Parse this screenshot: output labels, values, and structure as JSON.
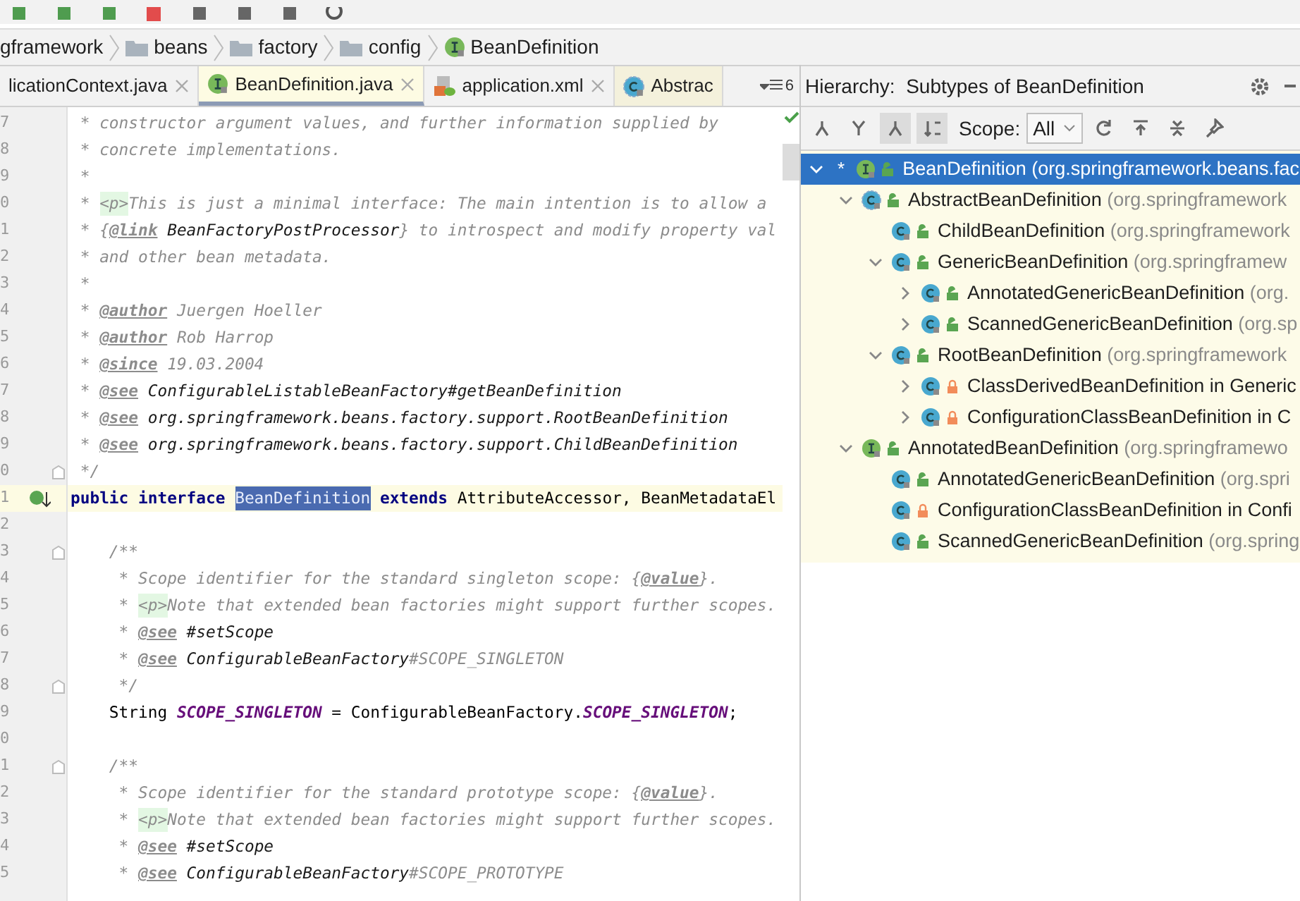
{
  "breadcrumb": [
    {
      "label": "gframework",
      "kind": "folder"
    },
    {
      "label": "beans",
      "kind": "folder"
    },
    {
      "label": "factory",
      "kind": "folder"
    },
    {
      "label": "config",
      "kind": "folder"
    },
    {
      "label": "BeanDefinition",
      "kind": "interface"
    }
  ],
  "tabs": [
    {
      "label": "licationContext.java",
      "kind": "class",
      "selected": false,
      "closable": true
    },
    {
      "label": "BeanDefinition.java",
      "kind": "interface",
      "selected": true,
      "closable": true
    },
    {
      "label": "application.xml",
      "kind": "xml",
      "selected": false,
      "closable": true
    },
    {
      "label": "Abstrac",
      "kind": "abstract",
      "selected": false,
      "closable": false
    }
  ],
  "tab_overflow_count": "6",
  "editor": {
    "lines": [
      {
        "number": "7",
        "segments": [
          {
            "text": " * constructor argument values, and further information supplied by",
            "kind": "comment"
          }
        ]
      },
      {
        "number": "8",
        "segments": [
          {
            "text": " * concrete implementations.",
            "kind": "comment"
          }
        ]
      },
      {
        "number": "9",
        "segments": [
          {
            "text": " *",
            "kind": "comment"
          }
        ]
      },
      {
        "number": "0",
        "segments": [
          {
            "text": " * ",
            "kind": "comment"
          },
          {
            "text": "<p>",
            "kind": "html"
          },
          {
            "text": "This is just a minimal interface: The main intention is to allow a",
            "kind": "comment"
          }
        ]
      },
      {
        "number": "1",
        "segments": [
          {
            "text": " * {",
            "kind": "comment"
          },
          {
            "text": "@link",
            "kind": "doctag"
          },
          {
            "text": " BeanFactoryPostProcessor",
            "kind": "ref"
          },
          {
            "text": "} to introspect and modify property val",
            "kind": "comment"
          }
        ]
      },
      {
        "number": "2",
        "segments": [
          {
            "text": " * and other bean metadata.",
            "kind": "comment"
          }
        ]
      },
      {
        "number": "3",
        "segments": [
          {
            "text": " *",
            "kind": "comment"
          }
        ]
      },
      {
        "number": "4",
        "segments": [
          {
            "text": " * ",
            "kind": "comment"
          },
          {
            "text": "@author",
            "kind": "doctag"
          },
          {
            "text": " Juergen Hoeller",
            "kind": "comment"
          }
        ]
      },
      {
        "number": "5",
        "segments": [
          {
            "text": " * ",
            "kind": "comment"
          },
          {
            "text": "@author",
            "kind": "doctag"
          },
          {
            "text": " Rob Harrop",
            "kind": "comment"
          }
        ]
      },
      {
        "number": "6",
        "segments": [
          {
            "text": " * ",
            "kind": "comment"
          },
          {
            "text": "@since",
            "kind": "doctag"
          },
          {
            "text": " 19.03.2004",
            "kind": "comment"
          }
        ]
      },
      {
        "number": "7",
        "segments": [
          {
            "text": " * ",
            "kind": "comment"
          },
          {
            "text": "@see",
            "kind": "doctag"
          },
          {
            "text": " ConfigurableListableBeanFactory#getBeanDefinition",
            "kind": "ref"
          }
        ]
      },
      {
        "number": "8",
        "segments": [
          {
            "text": " * ",
            "kind": "comment"
          },
          {
            "text": "@see",
            "kind": "doctag"
          },
          {
            "text": " org.springframework.beans.factory.support.RootBeanDefinition",
            "kind": "ref"
          }
        ]
      },
      {
        "number": "9",
        "segments": [
          {
            "text": " * ",
            "kind": "comment"
          },
          {
            "text": "@see",
            "kind": "doctag"
          },
          {
            "text": " org.springframework.beans.factory.support.ChildBeanDefinition",
            "kind": "ref"
          }
        ]
      },
      {
        "number": "0",
        "fold": true,
        "segments": [
          {
            "text": " */",
            "kind": "comment"
          }
        ]
      },
      {
        "number": "1",
        "current": true,
        "marker": true,
        "segments": [
          {
            "text": "public interface ",
            "kind": "keyword"
          },
          {
            "text": "BeanDefinition",
            "kind": "selection"
          },
          {
            "text": " extends ",
            "kind": "keyword"
          },
          {
            "text": "AttributeAccessor, BeanMetadataEl",
            "kind": "plain"
          }
        ]
      },
      {
        "number": "2"
      },
      {
        "number": "3",
        "fold": true,
        "segments": [
          {
            "text": "    /**",
            "kind": "comment"
          }
        ]
      },
      {
        "number": "4",
        "segments": [
          {
            "text": "     * Scope identifier for the standard singleton scope: {",
            "kind": "comment"
          },
          {
            "text": "@value",
            "kind": "doctag"
          },
          {
            "text": "}.",
            "kind": "comment"
          }
        ]
      },
      {
        "number": "5",
        "segments": [
          {
            "text": "     * ",
            "kind": "comment"
          },
          {
            "text": "<p>",
            "kind": "html"
          },
          {
            "text": "Note that extended bean factories might support further scopes.",
            "kind": "comment"
          }
        ]
      },
      {
        "number": "6",
        "segments": [
          {
            "text": "     * ",
            "kind": "comment"
          },
          {
            "text": "@see",
            "kind": "doctag"
          },
          {
            "text": " #setScope",
            "kind": "ref"
          }
        ]
      },
      {
        "number": "7",
        "segments": [
          {
            "text": "     * ",
            "kind": "comment"
          },
          {
            "text": "@see",
            "kind": "doctag"
          },
          {
            "text": " ConfigurableBeanFactory",
            "kind": "ref"
          },
          {
            "text": "#SCOPE_SINGLETON",
            "kind": "comment"
          }
        ]
      },
      {
        "number": "8",
        "fold": true,
        "segments": [
          {
            "text": "     */",
            "kind": "comment"
          }
        ]
      },
      {
        "number": "9",
        "segments": [
          {
            "text": "    String ",
            "kind": "plain"
          },
          {
            "text": "SCOPE_SINGLETON",
            "kind": "constant"
          },
          {
            "text": " = ConfigurableBeanFactory.",
            "kind": "plain"
          },
          {
            "text": "SCOPE_SINGLETON",
            "kind": "constant"
          },
          {
            "text": ";",
            "kind": "plain"
          }
        ]
      },
      {
        "number": "0"
      },
      {
        "number": "1",
        "fold": true,
        "segments": [
          {
            "text": "    /**",
            "kind": "comment"
          }
        ]
      },
      {
        "number": "2",
        "segments": [
          {
            "text": "     * Scope identifier for the standard prototype scope: {",
            "kind": "comment"
          },
          {
            "text": "@value",
            "kind": "doctag"
          },
          {
            "text": "}.",
            "kind": "comment"
          }
        ]
      },
      {
        "number": "3",
        "segments": [
          {
            "text": "     * ",
            "kind": "comment"
          },
          {
            "text": "<p>",
            "kind": "html"
          },
          {
            "text": "Note that extended bean factories might support further scopes.",
            "kind": "comment"
          }
        ]
      },
      {
        "number": "4",
        "segments": [
          {
            "text": "     * ",
            "kind": "comment"
          },
          {
            "text": "@see",
            "kind": "doctag"
          },
          {
            "text": " #setScope",
            "kind": "ref"
          }
        ]
      },
      {
        "number": "5",
        "segments": [
          {
            "text": "     * ",
            "kind": "comment"
          },
          {
            "text": "@see",
            "kind": "doctag"
          },
          {
            "text": " ConfigurableBeanFactory",
            "kind": "ref"
          },
          {
            "text": "#SCOPE_PROTOTYPE",
            "kind": "comment"
          }
        ]
      }
    ]
  },
  "hierarchy": {
    "title": "Hierarchy:  Subtypes of BeanDefinition",
    "scope_label": "Scope:",
    "scope_value": "All",
    "tree": [
      {
        "name": "BeanDefinition",
        "package": " (org.springframework.beans.fac",
        "kind": "interface",
        "locked": false,
        "star": "*",
        "selected": true,
        "expanded": true,
        "children": [
          {
            "name": "AbstractBeanDefinition",
            "package": " (org.springframework",
            "kind": "abstract",
            "locked": false,
            "selected": false,
            "expanded": true,
            "children": [
              {
                "name": "ChildBeanDefinition",
                "package": " (org.springframework",
                "kind": "class",
                "locked": false,
                "selected": false
              },
              {
                "name": "GenericBeanDefinition",
                "package": " (org.springframew",
                "kind": "class",
                "locked": false,
                "selected": false,
                "expanded": true,
                "children": [
                  {
                    "name": "AnnotatedGenericBeanDefinition",
                    "package": " (org.",
                    "kind": "class",
                    "locked": false,
                    "selected": false,
                    "expanded": false
                  },
                  {
                    "name": "ScannedGenericBeanDefinition",
                    "package": " (org.sp",
                    "kind": "class",
                    "locked": false,
                    "selected": false,
                    "expanded": false
                  }
                ]
              },
              {
                "name": "RootBeanDefinition",
                "package": " (org.springframework",
                "kind": "class",
                "locked": false,
                "selected": false,
                "expanded": true,
                "children": [
                  {
                    "name": "ClassDerivedBeanDefinition in Generic",
                    "kind": "class",
                    "locked": true,
                    "selected": false,
                    "expanded": false
                  },
                  {
                    "name": "ConfigurationClassBeanDefinition in C",
                    "kind": "class",
                    "locked": true,
                    "selected": false,
                    "expanded": false
                  }
                ]
              }
            ]
          },
          {
            "name": "AnnotatedBeanDefinition",
            "package": " (org.springframewo",
            "kind": "interface",
            "locked": false,
            "selected": false,
            "expanded": true,
            "children": [
              {
                "name": "AnnotatedGenericBeanDefinition",
                "package": " (org.spri",
                "kind": "class",
                "locked": false,
                "selected": false
              },
              {
                "name": "ConfigurationClassBeanDefinition in Confi",
                "kind": "class",
                "locked": true,
                "selected": false
              },
              {
                "name": "ScannedGenericBeanDefinition",
                "package": " (org.spring",
                "kind": "class",
                "locked": false,
                "selected": false
              }
            ]
          }
        ]
      }
    ]
  }
}
